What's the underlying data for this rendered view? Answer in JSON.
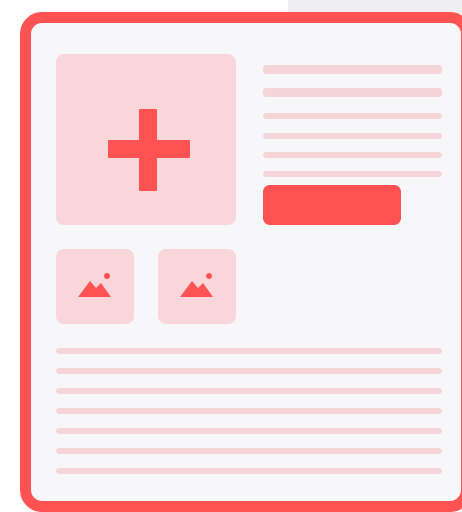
{
  "screen": {
    "description_text": ""
  },
  "icons": {
    "add": "plus-icon",
    "image": "image-icon"
  },
  "colors": {
    "accent": "#ff5252",
    "placeholder_fill": "#f8d6d9",
    "skeleton_line": "#f5d5d8",
    "card_background": "#f7f7f9"
  },
  "main_image": {
    "icon": "plus-icon"
  },
  "thumbnails": [
    {
      "icon": "image-icon"
    },
    {
      "icon": "image-icon"
    }
  ],
  "primary_button": {
    "label": ""
  }
}
